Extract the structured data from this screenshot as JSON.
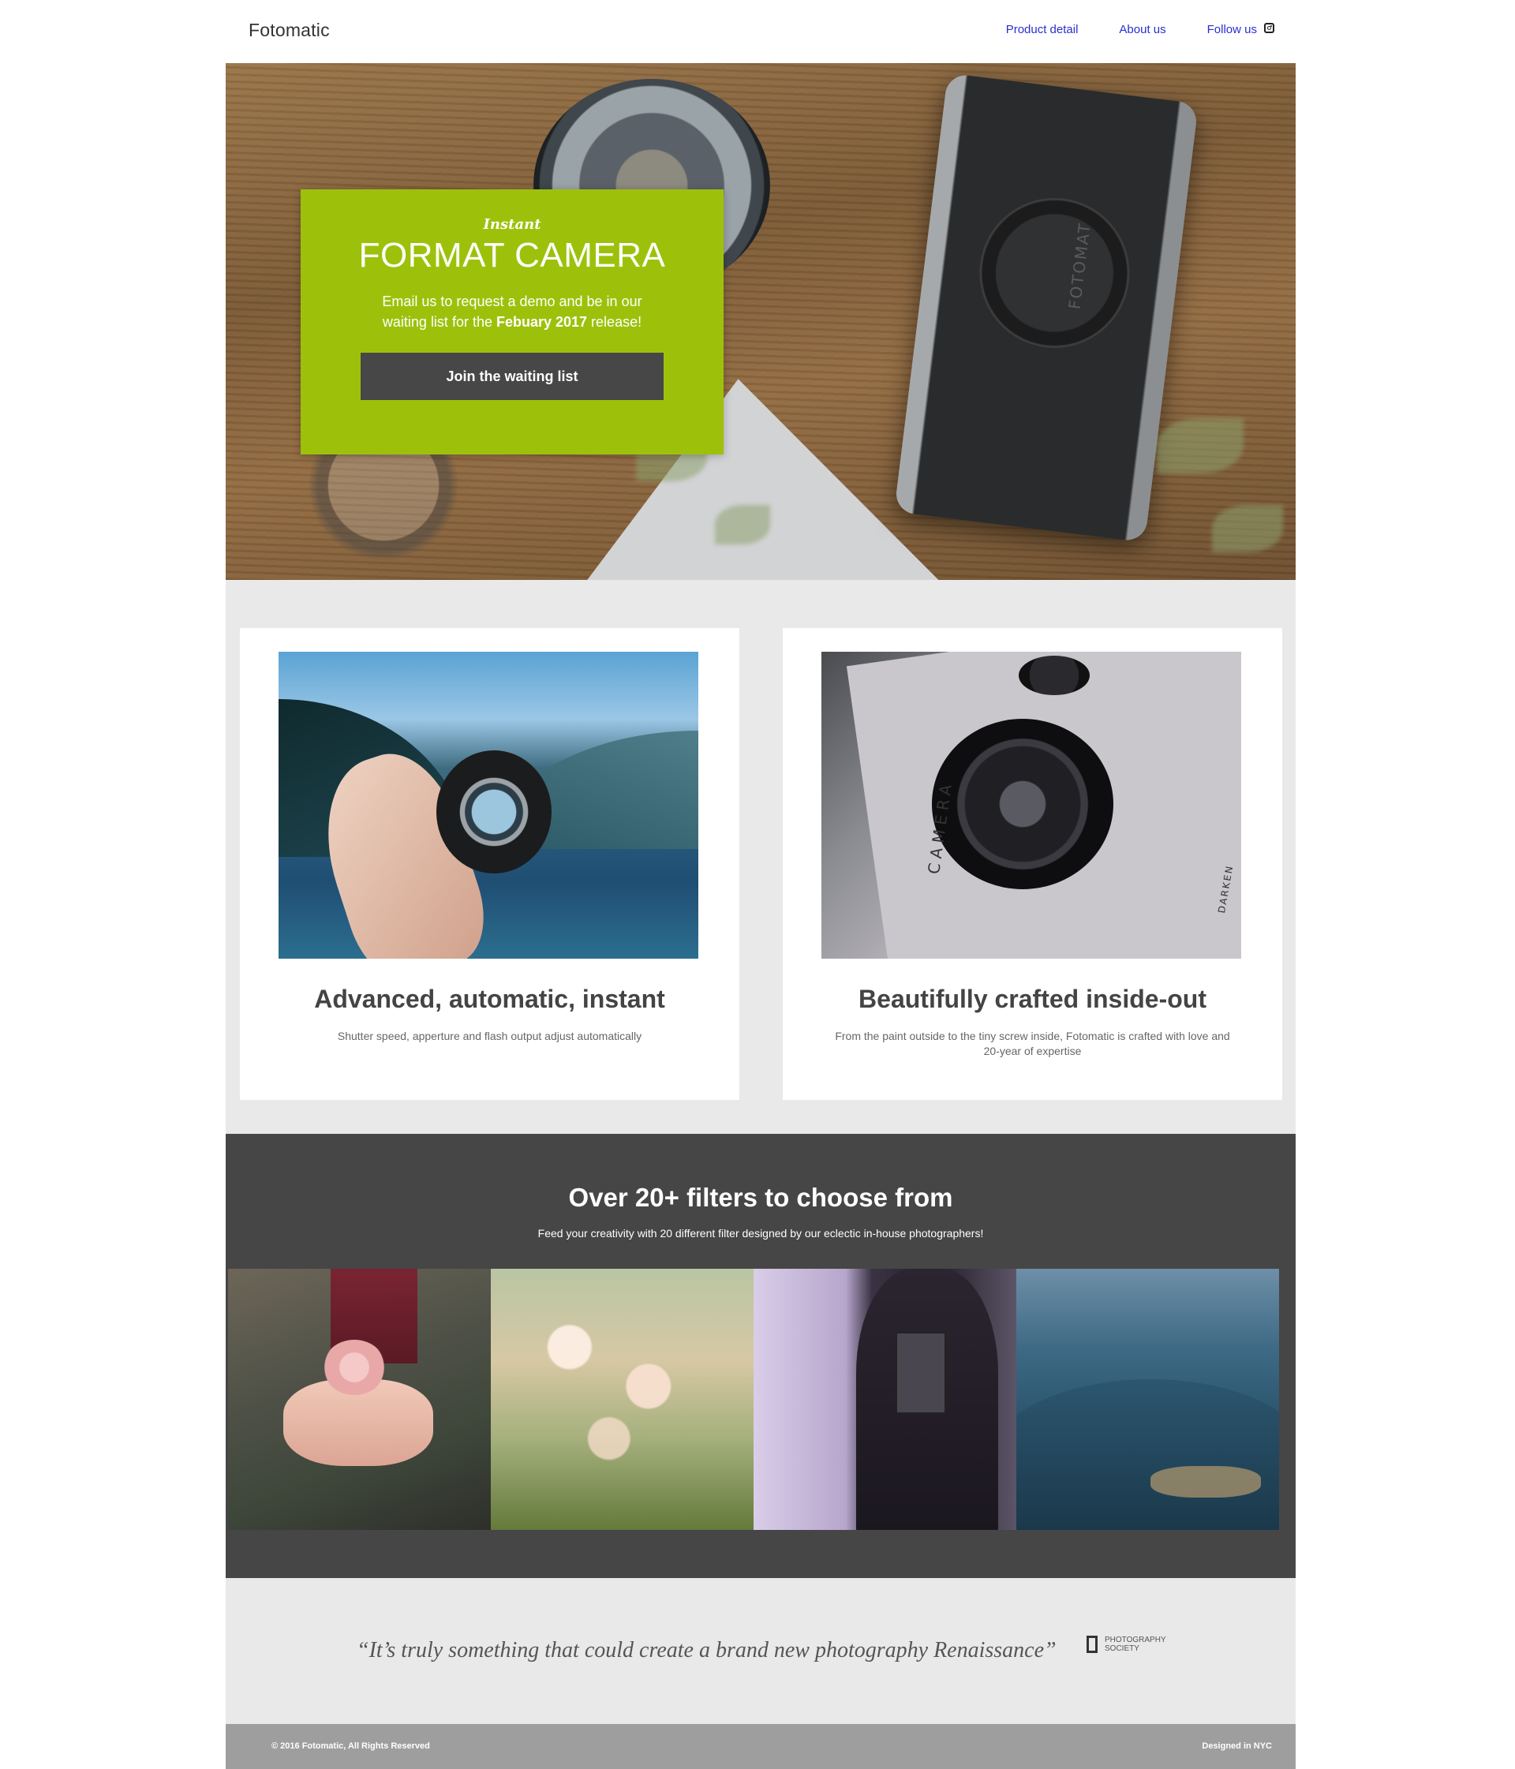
{
  "nav": {
    "brand": "Fotomatic",
    "links": [
      {
        "label": "Product detail"
      },
      {
        "label": "About us"
      },
      {
        "label": "Follow us",
        "icon": "instagram-icon"
      }
    ]
  },
  "hero": {
    "camera_label": "FOTOMAT",
    "kicker": "Instant",
    "title": "FORMAT CAMERA",
    "text_before": "Email us to request a demo and be in our waiting list for the ",
    "text_bold": "Febuary 2017",
    "text_after": " release!",
    "button_label": "Join the waiting list",
    "accent_color": "#9dc10b"
  },
  "features": [
    {
      "title": "Advanced, automatic, instant",
      "description": "Shutter speed, apperture and flash output adjust automatically"
    },
    {
      "title": "Beautifully crafted inside-out",
      "description": "From the paint outside to the tiny screw inside, Fotomatic is crafted with love and 20-year of expertise",
      "image_text": [
        "CAMERA",
        "DARKEN"
      ]
    }
  ],
  "filters": {
    "title": "Over 20+ filters to choose from",
    "subtitle": "Feed your creativity with 20 different filter designed by our eclectic in-house photographers!"
  },
  "quote": {
    "text": "“It’s truly something that could create a brand new photography Renaissance”",
    "source_line1": "PHOTOGRAPHY",
    "source_line2": "SOCIETY"
  },
  "footer": {
    "copyright": "© 2016 Fotomatic, All Rights Reserved",
    "credit": "Designed in NYC"
  }
}
